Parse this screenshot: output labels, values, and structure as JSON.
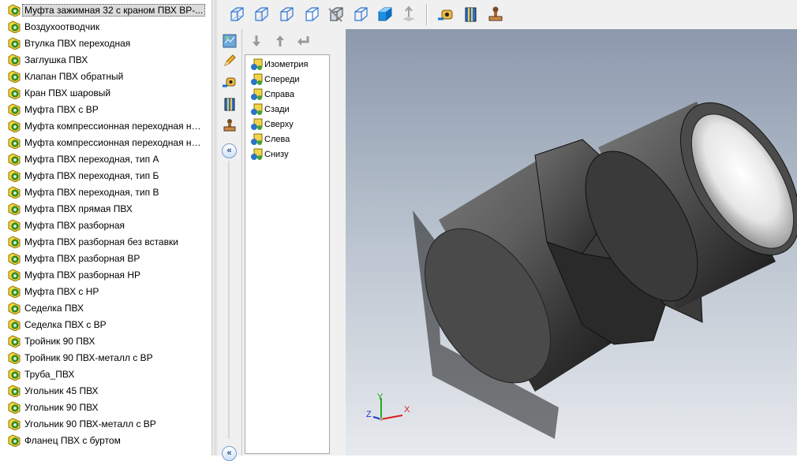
{
  "parts_list": {
    "items": [
      "Муфта зажимная 32 с краном ПВХ ВР-...",
      "Воздухоотводчик",
      "Втулка ПВХ переходная",
      "Заглушка ПВХ",
      "Клапан ПВХ обратный",
      "Кран ПВХ шаровый",
      "Муфта  ПВХ с ВР",
      "Муфта компрессионная переходная на...",
      "Муфта компрессионная переходная на...",
      "Муфта ПВХ переходная, тип А",
      "Муфта ПВХ переходная, тип Б",
      "Муфта ПВХ переходная, тип В",
      "Муфта ПВХ прямая ПВХ",
      "Муфта ПВХ разборная",
      "Муфта ПВХ разборная без вставки",
      "Муфта ПВХ разборная ВР",
      "Муфта ПВХ разборная НР",
      "Муфта ПВХ с НР",
      "Седелка ПВХ",
      "Седелка ПВХ с ВР",
      "Тройник 90 ПВХ",
      "Тройник 90 ПВХ-металл с ВР",
      "Труба_ПВХ",
      "Угольник 45 ПВХ",
      "Угольник 90 ПВХ",
      "Угольник 90 ПВХ-металл с ВР",
      "Фланец  ПВХ с буртом"
    ],
    "selected_index": 0
  },
  "toolbar": {
    "icons": [
      "view-cube-wireframe-icon",
      "view-cube-hidden-lines-icon",
      "view-cube-edges-icon",
      "view-cube-front-icon",
      "view-cube-section-icon",
      "view-cube-outline-icon",
      "view-cube-shaded-icon",
      "normal-to-icon",
      "measure-tape-icon",
      "material-icon",
      "stamp-icon"
    ]
  },
  "side_icons": [
    "view-orientation-icon",
    "pencil-icon",
    "measure-icon",
    "material-icon",
    "stamp-icon"
  ],
  "view_panel": {
    "views": [
      "Изометрия",
      "Спереди",
      "Справа",
      "Сзади",
      "Сверху",
      "Слева",
      "Снизу"
    ]
  },
  "triad": {
    "x_label": "X",
    "y_label": "Y",
    "z_label": "Z"
  },
  "colors": {
    "selection_bg": "#dcdcdc",
    "accent": "#2b74d4",
    "viewport_top": "#8c99ad",
    "viewport_bottom": "#e7eaee"
  }
}
